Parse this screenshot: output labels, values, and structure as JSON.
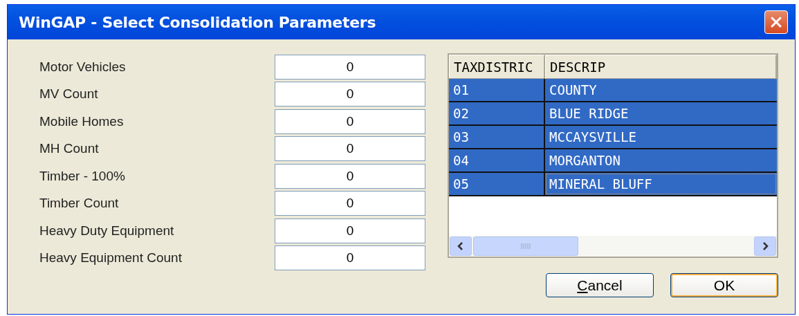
{
  "window": {
    "title": "WinGAP - Select Consolidation Parameters"
  },
  "fields": [
    {
      "label": "Motor Vehicles",
      "value": "0"
    },
    {
      "label": "MV Count",
      "value": "0"
    },
    {
      "label": "Mobile Homes",
      "value": "0"
    },
    {
      "label": "MH Count",
      "value": "0"
    },
    {
      "label": "Timber - 100%",
      "value": "0"
    },
    {
      "label": "Timber Count",
      "value": "0"
    },
    {
      "label": "Heavy Duty Equipment",
      "value": "0"
    },
    {
      "label": "Heavy Equipment Count",
      "value": "0"
    }
  ],
  "grid": {
    "columns": [
      "TAXDISTRIC",
      "DESCRIP"
    ],
    "rows": [
      {
        "cells": [
          "01",
          "COUNTY"
        ],
        "selected": true,
        "focused": false
      },
      {
        "cells": [
          "02",
          "BLUE RIDGE"
        ],
        "selected": true,
        "focused": false
      },
      {
        "cells": [
          "03",
          "MCCAYSVILLE"
        ],
        "selected": true,
        "focused": false
      },
      {
        "cells": [
          "04",
          "MORGANTON"
        ],
        "selected": true,
        "focused": false
      },
      {
        "cells": [
          "05",
          "MINERAL BLUFF"
        ],
        "selected": true,
        "focused": true
      }
    ]
  },
  "buttons": [
    {
      "label": "Cancel",
      "default": false
    },
    {
      "label": "OK",
      "default": true
    }
  ]
}
